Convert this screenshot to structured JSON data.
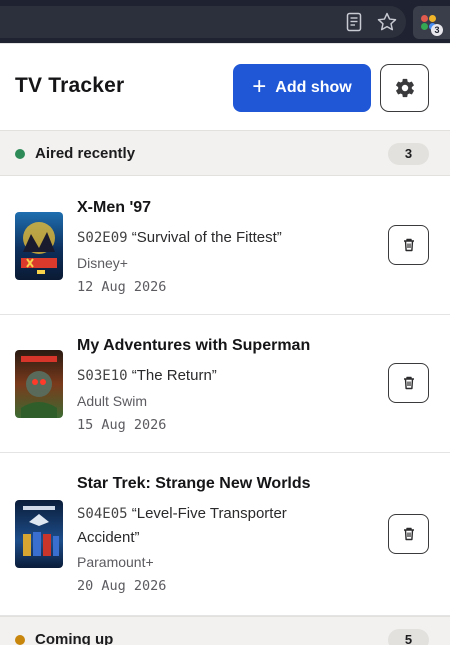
{
  "browser": {
    "extension_badge": "3",
    "icons": [
      "reader-mode-icon",
      "bookmark-star-icon",
      "extension-icon"
    ]
  },
  "app": {
    "title": "TV Tracker",
    "add_button_label": "Add show",
    "add_icon": "+",
    "settings_icon": "gear-icon"
  },
  "sections": [
    {
      "label": "Aired recently",
      "count": "3",
      "dot_color": "#2e8b57",
      "shows": [
        {
          "title": "X-Men '97",
          "episode_code": "S02E09",
          "episode_title": "“Survival of the Fittest”",
          "network": "Disney+",
          "date": "12 Aug 2026"
        },
        {
          "title": "My Adventures with Superman",
          "episode_code": "S03E10",
          "episode_title": "“The Return”",
          "network": "Adult Swim",
          "date": "15 Aug 2026"
        },
        {
          "title": "Star Trek: Strange New Worlds",
          "episode_code": "S04E05",
          "episode_title": "“Level-Five Transporter Accident”",
          "network": "Paramount+",
          "date": "20 Aug 2026"
        }
      ]
    },
    {
      "label": "Coming up",
      "count": "5",
      "dot_color": "#c8860d"
    }
  ],
  "colors": {
    "accent": "#1f57d6",
    "section_bg": "#f2f1ef"
  }
}
